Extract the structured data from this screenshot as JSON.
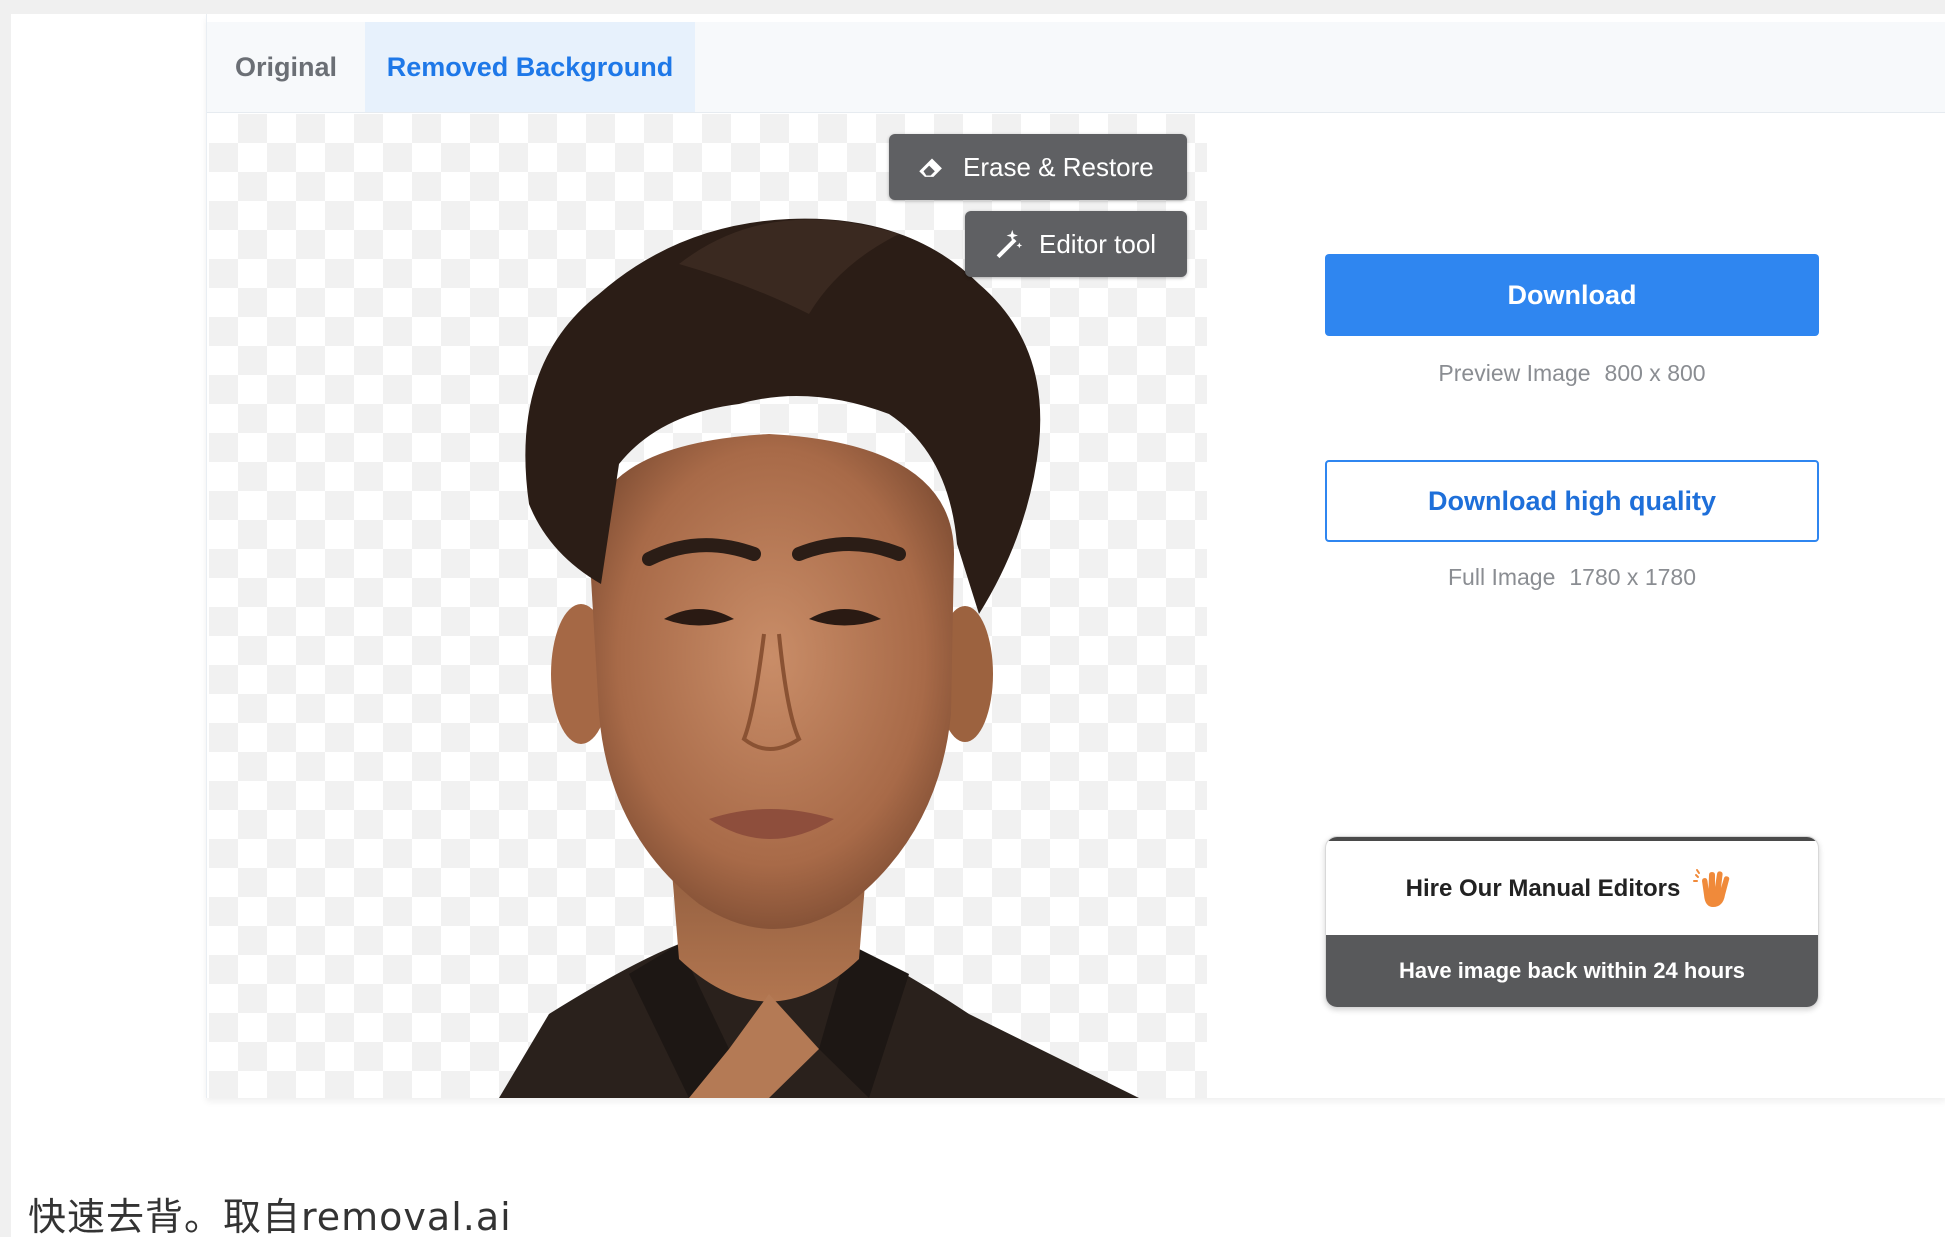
{
  "tabs": {
    "original": "Original",
    "removed_background": "Removed Background"
  },
  "tools": {
    "erase_restore": "Erase & Restore",
    "editor_tool": "Editor tool"
  },
  "download": {
    "button": "Download",
    "preview_label": "Preview Image",
    "preview_size": "800 x 800"
  },
  "download_hq": {
    "button": "Download high quality",
    "full_label": "Full Image",
    "full_size": "1780 x 1780"
  },
  "hire": {
    "title": "Hire Our Manual Editors",
    "subtitle": "Have image back within 24 hours"
  },
  "caption": "快速去背。取自removal.ai",
  "colors": {
    "accent": "#2f86f0",
    "active_tab_bg": "#e7f1fc",
    "tool_button": "#5f6063",
    "hire_banner": "#58595b"
  }
}
